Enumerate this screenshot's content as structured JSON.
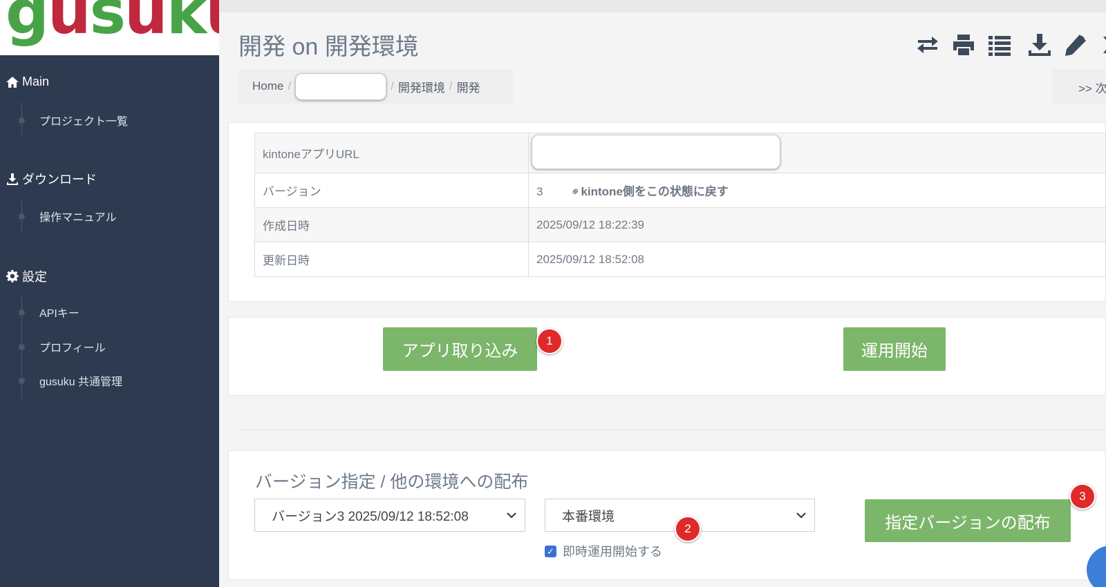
{
  "logo": {
    "text": "gusuku",
    "colors": [
      "#48a348",
      "#c0283d",
      "#48a348",
      "#c0283d",
      "#48a348",
      "#c0283d"
    ]
  },
  "sidebar": {
    "sections": [
      {
        "label": "Main",
        "icon": "home-icon",
        "items": [
          "プロジェクト一覧"
        ]
      },
      {
        "label": "ダウンロード",
        "icon": "download-icon",
        "items": [
          "操作マニュアル"
        ]
      },
      {
        "label": "設定",
        "icon": "gear-icon",
        "items": [
          "APIキー",
          "プロフィール",
          "gusuku 共通管理"
        ]
      }
    ]
  },
  "header": {
    "title": "開発 on 開発環境",
    "toolbar": [
      "swap-icon",
      "print-icon",
      "list-icon",
      "download-icon",
      "edit-icon",
      "close-icon"
    ]
  },
  "breadcrumb": {
    "home": "Home",
    "env": "開発環境",
    "current": "開発"
  },
  "next_link": ">> 次",
  "info": {
    "rows": [
      {
        "label": "kintoneアプリURL",
        "value": ""
      },
      {
        "label": "バージョン",
        "value": "3",
        "action": "kintone側をこの状態に戻す"
      },
      {
        "label": "作成日時",
        "value": "2025/09/12 18:22:39"
      },
      {
        "label": "更新日時",
        "value": "2025/09/12 18:52:08"
      }
    ]
  },
  "actions": {
    "import_label": "アプリ取り込み",
    "start_label": "運用開始"
  },
  "deploy": {
    "title": "バージョン指定 / 他の環境への配布",
    "version_select": "バージョン3 2025/09/12 18:52:08",
    "env_select": "本番環境",
    "checkbox_label": "即時運用開始する",
    "checkbox_checked": true,
    "deploy_label": "指定バージョンの配布"
  },
  "badges": [
    "1",
    "2",
    "3"
  ],
  "colors": {
    "sidebar": "#2e3a4f",
    "accent_green": "#7cb66a",
    "badge_red": "#e02a2a",
    "checkbox_blue": "#3b6fd4"
  }
}
